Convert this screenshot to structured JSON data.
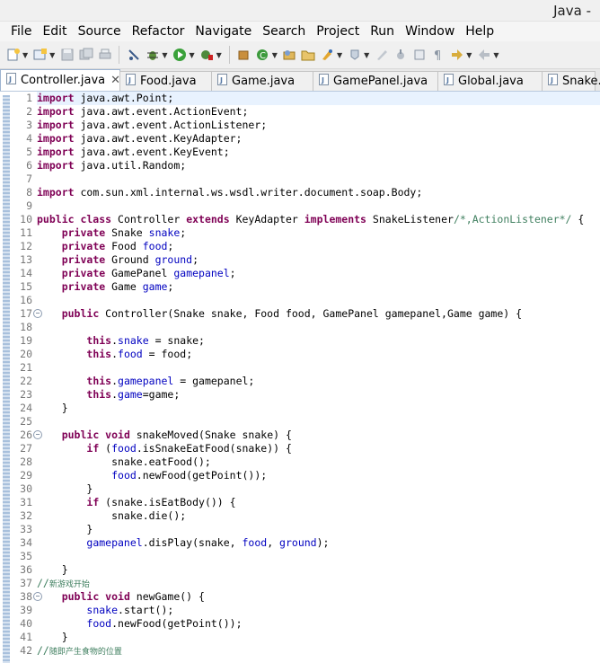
{
  "window": {
    "title": "Java -"
  },
  "menu": [
    "File",
    "Edit",
    "Source",
    "Refactor",
    "Navigate",
    "Search",
    "Project",
    "Run",
    "Window",
    "Help"
  ],
  "tabs": [
    {
      "label": "Controller.java",
      "active": true,
      "close": "✕"
    },
    {
      "label": "Food.java",
      "active": false
    },
    {
      "label": "Game.java",
      "active": false
    },
    {
      "label": "GamePanel.java",
      "active": false
    },
    {
      "label": "Global.java",
      "active": false
    },
    {
      "label": "Snake.",
      "active": false
    }
  ],
  "code_lines": [
    {
      "n": "1",
      "tokens": [
        [
          "kw",
          "import"
        ],
        [
          "p",
          " java.awt.Point;"
        ]
      ]
    },
    {
      "n": "2",
      "tokens": [
        [
          "kw",
          "import"
        ],
        [
          "p",
          " java.awt.event.ActionEvent;"
        ]
      ]
    },
    {
      "n": "3",
      "tokens": [
        [
          "kw",
          "import"
        ],
        [
          "p",
          " java.awt.event.ActionListener;"
        ]
      ]
    },
    {
      "n": "4",
      "tokens": [
        [
          "kw",
          "import"
        ],
        [
          "p",
          " java.awt.event.KeyAdapter;"
        ]
      ]
    },
    {
      "n": "5",
      "tokens": [
        [
          "kw",
          "import"
        ],
        [
          "p",
          " java.awt.event.KeyEvent;"
        ]
      ]
    },
    {
      "n": "6",
      "tokens": [
        [
          "kw",
          "import"
        ],
        [
          "p",
          " java.util.Random;"
        ]
      ]
    },
    {
      "n": "7",
      "tokens": []
    },
    {
      "n": "8",
      "tokens": [
        [
          "kw",
          "import"
        ],
        [
          "p",
          " com.sun.xml.internal.ws.wsdl.writer.document.soap.Body;"
        ]
      ]
    },
    {
      "n": "9",
      "tokens": []
    },
    {
      "n": "10",
      "tokens": [
        [
          "kw",
          "public class"
        ],
        [
          "p",
          " Controller "
        ],
        [
          "kw",
          "extends"
        ],
        [
          "p",
          " KeyAdapter "
        ],
        [
          "kw",
          "implements"
        ],
        [
          "p",
          " SnakeListener"
        ],
        [
          "cmt",
          "/*,ActionListener*/"
        ],
        [
          "p",
          " {"
        ]
      ]
    },
    {
      "n": "11",
      "tokens": [
        [
          "p",
          "    "
        ],
        [
          "kw",
          "private"
        ],
        [
          "p",
          " Snake "
        ],
        [
          "fld",
          "snake"
        ],
        [
          "p",
          ";"
        ]
      ]
    },
    {
      "n": "12",
      "tokens": [
        [
          "p",
          "    "
        ],
        [
          "kw",
          "private"
        ],
        [
          "p",
          " Food "
        ],
        [
          "fld",
          "food"
        ],
        [
          "p",
          ";"
        ]
      ]
    },
    {
      "n": "13",
      "tokens": [
        [
          "p",
          "    "
        ],
        [
          "kw",
          "private"
        ],
        [
          "p",
          " Ground "
        ],
        [
          "fld",
          "ground"
        ],
        [
          "p",
          ";"
        ]
      ]
    },
    {
      "n": "14",
      "tokens": [
        [
          "p",
          "    "
        ],
        [
          "kw",
          "private"
        ],
        [
          "p",
          " GamePanel "
        ],
        [
          "fld",
          "gamepanel"
        ],
        [
          "p",
          ";"
        ]
      ]
    },
    {
      "n": "15",
      "tokens": [
        [
          "p",
          "    "
        ],
        [
          "kw",
          "private"
        ],
        [
          "p",
          " Game "
        ],
        [
          "fld",
          "game"
        ],
        [
          "p",
          ";"
        ]
      ]
    },
    {
      "n": "16",
      "tokens": []
    },
    {
      "n": "17",
      "fold": true,
      "tokens": [
        [
          "p",
          "    "
        ],
        [
          "kw",
          "public"
        ],
        [
          "p",
          " Controller(Snake snake, Food food, GamePanel gamepanel,Game game) {"
        ]
      ]
    },
    {
      "n": "18",
      "tokens": []
    },
    {
      "n": "19",
      "tokens": [
        [
          "p",
          "        "
        ],
        [
          "kw",
          "this"
        ],
        [
          "p",
          "."
        ],
        [
          "fld",
          "snake"
        ],
        [
          "p",
          " = snake;"
        ]
      ]
    },
    {
      "n": "20",
      "tokens": [
        [
          "p",
          "        "
        ],
        [
          "kw",
          "this"
        ],
        [
          "p",
          "."
        ],
        [
          "fld",
          "food"
        ],
        [
          "p",
          " = food;"
        ]
      ]
    },
    {
      "n": "21",
      "tokens": []
    },
    {
      "n": "22",
      "tokens": [
        [
          "p",
          "        "
        ],
        [
          "kw",
          "this"
        ],
        [
          "p",
          "."
        ],
        [
          "fld",
          "gamepanel"
        ],
        [
          "p",
          " = gamepanel;"
        ]
      ]
    },
    {
      "n": "23",
      "tokens": [
        [
          "p",
          "        "
        ],
        [
          "kw",
          "this"
        ],
        [
          "p",
          "."
        ],
        [
          "fld",
          "game"
        ],
        [
          "p",
          "=game;"
        ]
      ]
    },
    {
      "n": "24",
      "tokens": [
        [
          "p",
          "    }"
        ]
      ]
    },
    {
      "n": "25",
      "tokens": []
    },
    {
      "n": "26",
      "fold": true,
      "tokens": [
        [
          "p",
          "    "
        ],
        [
          "kw",
          "public void"
        ],
        [
          "p",
          " snakeMoved(Snake snake) {"
        ]
      ]
    },
    {
      "n": "27",
      "tokens": [
        [
          "p",
          "        "
        ],
        [
          "kw",
          "if"
        ],
        [
          "p",
          " ("
        ],
        [
          "fld",
          "food"
        ],
        [
          "p",
          ".isSnakeEatFood(snake)) {"
        ]
      ]
    },
    {
      "n": "28",
      "tokens": [
        [
          "p",
          "            snake.eatFood();"
        ]
      ]
    },
    {
      "n": "29",
      "tokens": [
        [
          "p",
          "            "
        ],
        [
          "fld",
          "food"
        ],
        [
          "p",
          ".newFood(getPoint());"
        ]
      ]
    },
    {
      "n": "30",
      "tokens": [
        [
          "p",
          "        }"
        ]
      ]
    },
    {
      "n": "31",
      "tokens": [
        [
          "p",
          "        "
        ],
        [
          "kw",
          "if"
        ],
        [
          "p",
          " (snake.isEatBody()) {"
        ]
      ]
    },
    {
      "n": "32",
      "tokens": [
        [
          "p",
          "            snake.die();"
        ]
      ]
    },
    {
      "n": "33",
      "tokens": [
        [
          "p",
          "        }"
        ]
      ]
    },
    {
      "n": "34",
      "tokens": [
        [
          "p",
          "        "
        ],
        [
          "fld",
          "gamepanel"
        ],
        [
          "p",
          ".disPlay(snake, "
        ],
        [
          "fld",
          "food"
        ],
        [
          "p",
          ", "
        ],
        [
          "fld",
          "ground"
        ],
        [
          "p",
          ");"
        ]
      ]
    },
    {
      "n": "35",
      "tokens": []
    },
    {
      "n": "36",
      "tokens": [
        [
          "p",
          "    }"
        ]
      ]
    },
    {
      "n": "37",
      "tokens": [
        [
          "cmt",
          "//"
        ],
        [
          "cmt-small",
          "新游戏开始"
        ]
      ]
    },
    {
      "n": "38",
      "fold": true,
      "tokens": [
        [
          "p",
          "    "
        ],
        [
          "kw",
          "public void"
        ],
        [
          "p",
          " newGame() {"
        ]
      ]
    },
    {
      "n": "39",
      "tokens": [
        [
          "p",
          "        "
        ],
        [
          "fld",
          "snake"
        ],
        [
          "p",
          ".start();"
        ]
      ]
    },
    {
      "n": "40",
      "tokens": [
        [
          "p",
          "        "
        ],
        [
          "fld",
          "food"
        ],
        [
          "p",
          ".newFood(getPoint());"
        ]
      ]
    },
    {
      "n": "41",
      "tokens": [
        [
          "p",
          "    }"
        ]
      ]
    },
    {
      "n": "42",
      "tokens": [
        [
          "cmt",
          "//"
        ],
        [
          "cmt-small",
          "随即产生食物的位置"
        ]
      ]
    }
  ]
}
